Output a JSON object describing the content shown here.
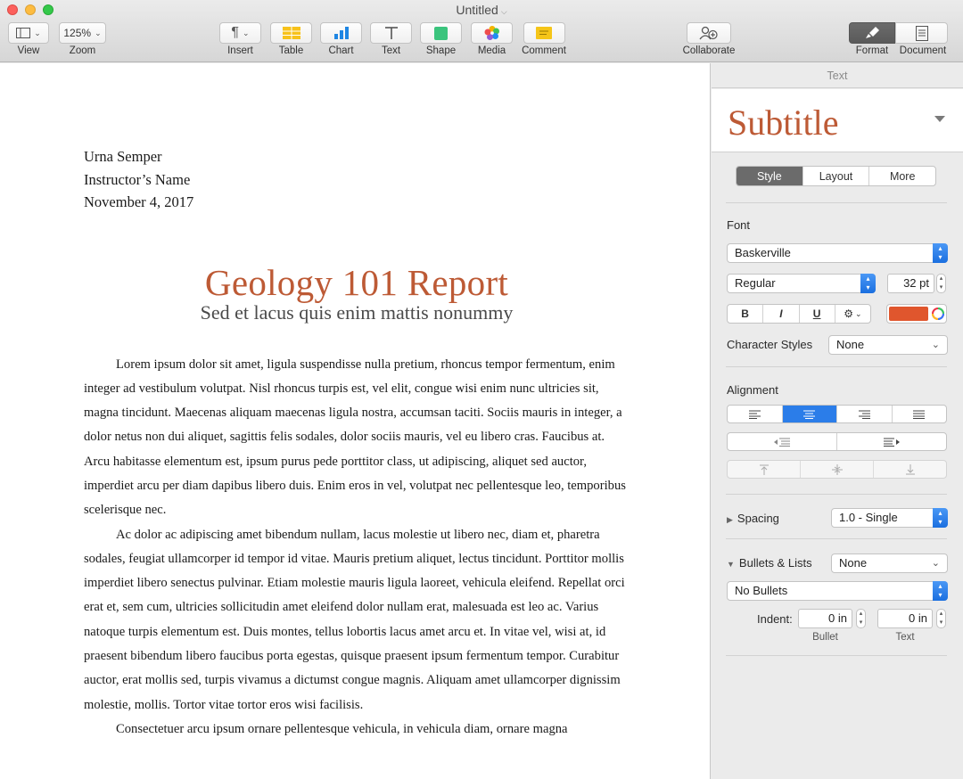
{
  "window": {
    "title": "Untitled"
  },
  "toolbar": {
    "view_label": "View",
    "zoom_value": "125%",
    "zoom_label": "Zoom",
    "insert_label": "Insert",
    "table_label": "Table",
    "chart_label": "Chart",
    "text_label": "Text",
    "shape_label": "Shape",
    "media_label": "Media",
    "comment_label": "Comment",
    "collaborate_label": "Collaborate",
    "format_label": "Format",
    "document_label": "Document"
  },
  "document": {
    "header_lines": [
      "Urna Semper",
      "Instructor’s Name",
      "November 4, 2017"
    ],
    "title": "Geology 101 Report",
    "subtitle": "Sed et lacus quis enim mattis nonummy",
    "paragraphs": [
      "Lorem ipsum dolor sit amet, ligula suspendisse nulla pretium, rhoncus tempor fermentum, enim integer ad vestibulum volutpat. Nisl rhoncus turpis est, vel elit, congue wisi enim nunc ultricies sit, magna tincidunt. Maecenas aliquam maecenas ligula nostra, accumsan taciti. Sociis mauris in integer, a dolor netus non dui aliquet, sagittis felis sodales, dolor sociis mauris, vel eu libero cras. Faucibus at. Arcu habitasse elementum est, ipsum purus pede porttitor class, ut adipiscing, aliquet sed auctor, imperdiet arcu per diam dapibus libero duis. Enim eros in vel, volutpat nec pellentesque leo, temporibus scelerisque nec.",
      "Ac dolor ac adipiscing amet bibendum nullam, lacus molestie ut libero nec, diam et, pharetra sodales, feugiat ullamcorper id tempor id vitae. Mauris pretium aliquet, lectus tincidunt. Porttitor mollis imperdiet libero senectus pulvinar. Etiam molestie mauris ligula laoreet, vehicula eleifend. Repellat orci erat et, sem cum, ultricies sollicitudin amet eleifend dolor nullam erat, malesuada est leo ac. Varius natoque turpis elementum est. Duis montes, tellus lobortis lacus amet arcu et. In vitae vel, wisi at, id praesent bibendum libero faucibus porta egestas, quisque praesent ipsum fermentum tempor. Curabitur auctor, erat mollis sed, turpis vivamus a dictumst congue magnis. Aliquam amet ullamcorper dignissim molestie, mollis. Tortor vitae tortor eros wisi facilisis.",
      "Consectetuer arcu ipsum ornare pellentesque vehicula, in vehicula diam, ornare magna"
    ]
  },
  "inspector": {
    "section_label": "Text",
    "paragraph_style": "Subtitle",
    "tabs": [
      "Style",
      "Layout",
      "More"
    ],
    "font_label": "Font",
    "font_family": "Baskerville",
    "font_typeface": "Regular",
    "font_size": "32 pt",
    "bold": "B",
    "italic": "I",
    "underline": "U",
    "gear": "⚙",
    "text_color": "#e0562d",
    "character_styles_label": "Character Styles",
    "character_styles_value": "None",
    "alignment_label": "Alignment",
    "spacing_label": "Spacing",
    "spacing_value": "1.0 - Single",
    "bullets_label": "Bullets & Lists",
    "bullets_value": "None",
    "bullet_type": "No Bullets",
    "indent_label": "Indent:",
    "indent_bullet_value": "0 in",
    "indent_text_value": "0 in",
    "bullet_sub": "Bullet",
    "text_sub": "Text"
  }
}
